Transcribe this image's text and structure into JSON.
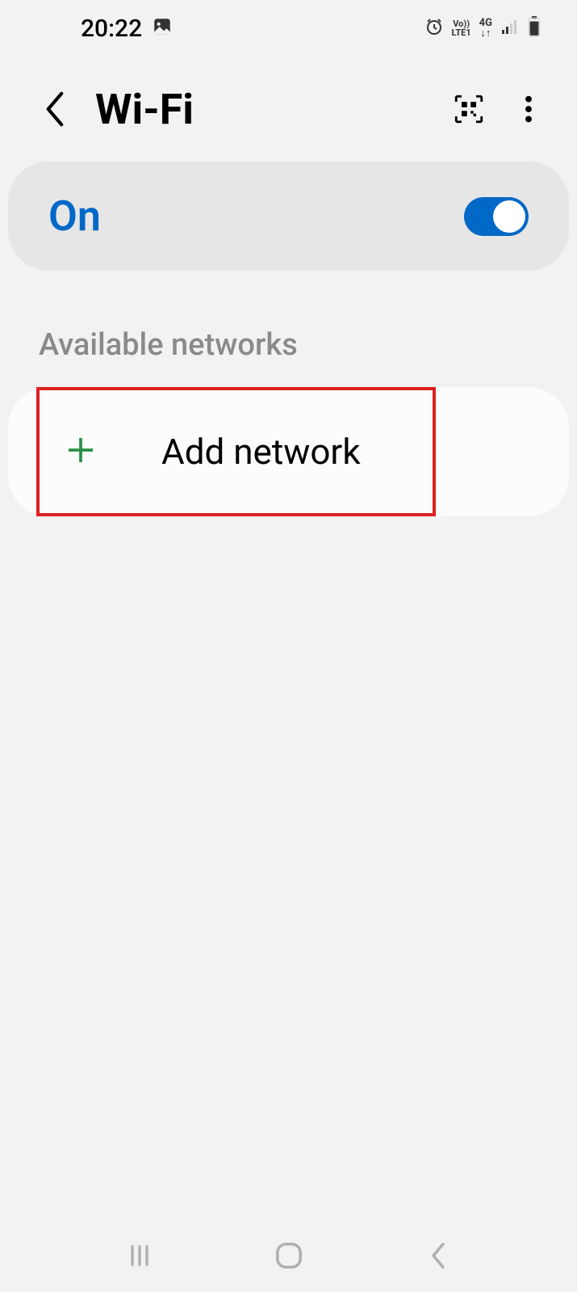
{
  "status_bar": {
    "time": "20:22"
  },
  "header": {
    "title": "Wi-Fi"
  },
  "toggle": {
    "label": "On",
    "state": true
  },
  "section": {
    "label": "Available networks"
  },
  "add_network": {
    "label": "Add network"
  }
}
